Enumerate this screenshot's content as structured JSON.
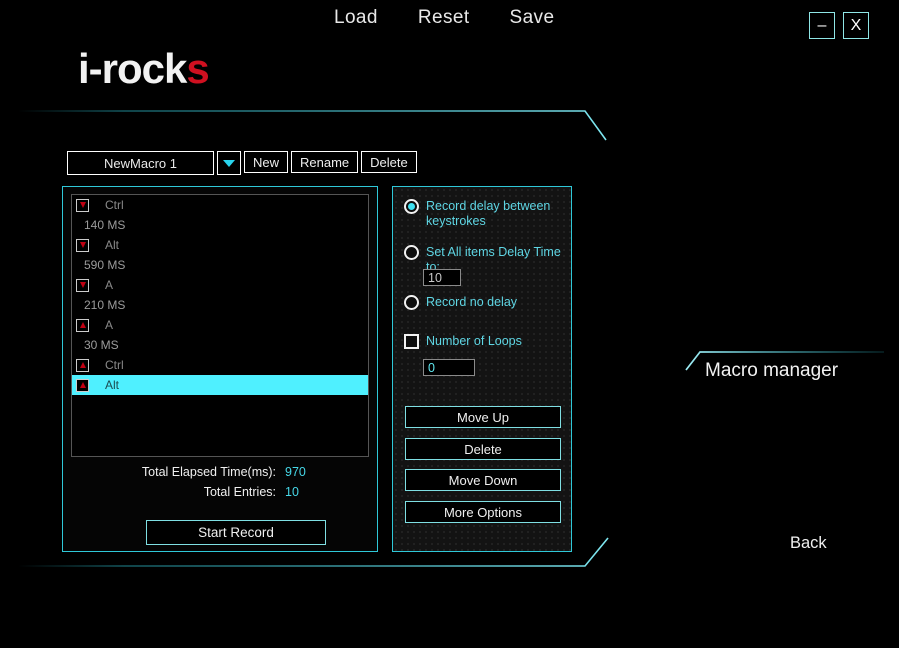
{
  "window": {
    "minimize_label": "–",
    "close_label": "X"
  },
  "topmenu": {
    "items": [
      {
        "label": "Load"
      },
      {
        "label": "Reset"
      },
      {
        "label": "Save"
      }
    ]
  },
  "logo": {
    "main": "i-rock",
    "accent": "s"
  },
  "macro_selector": {
    "current": "NewMacro 1",
    "dropdown_icon": "chevron-down-icon",
    "new_label": "New",
    "rename_label": "Rename",
    "delete_label": "Delete"
  },
  "macro_list": {
    "rows": [
      {
        "type": "key",
        "dir": "down",
        "text": "Ctrl",
        "selected": false
      },
      {
        "type": "delay",
        "dir": "",
        "text": "140 MS",
        "selected": false
      },
      {
        "type": "key",
        "dir": "down",
        "text": "Alt",
        "selected": false
      },
      {
        "type": "delay",
        "dir": "",
        "text": "590 MS",
        "selected": false
      },
      {
        "type": "key",
        "dir": "down",
        "text": "A",
        "selected": false
      },
      {
        "type": "delay",
        "dir": "",
        "text": "210 MS",
        "selected": false
      },
      {
        "type": "key",
        "dir": "up",
        "text": "A",
        "selected": false
      },
      {
        "type": "delay",
        "dir": "",
        "text": "30 MS",
        "selected": false
      },
      {
        "type": "key",
        "dir": "up",
        "text": "Ctrl",
        "selected": false
      },
      {
        "type": "key",
        "dir": "up",
        "text": "Alt",
        "selected": true
      }
    ]
  },
  "stats": {
    "elapsed_label": "Total Elapsed Time(ms):",
    "elapsed_value": "970",
    "entries_label": "Total Entries:",
    "entries_value": "10"
  },
  "record_button": {
    "label": "Start Record"
  },
  "options": {
    "record_delay_label": "Record delay between keystrokes",
    "record_delay_selected": true,
    "set_all_label": "Set All items Delay Time to:",
    "set_all_selected": false,
    "set_all_value": "10",
    "no_delay_label": "Record no delay",
    "no_delay_selected": false,
    "loops_label": "Number of Loops",
    "loops_checked": false,
    "loops_value": "0"
  },
  "action_buttons": [
    {
      "label": "Move Up"
    },
    {
      "label": "Delete"
    },
    {
      "label": "Move Down"
    },
    {
      "label": "More Options"
    }
  ],
  "page": {
    "title": "Macro manager",
    "back_label": "Back"
  },
  "colors": {
    "accent_cyan": "#2fc8d8",
    "highlight_cyan": "#4ff0ff",
    "logo_red": "#cf1020"
  }
}
